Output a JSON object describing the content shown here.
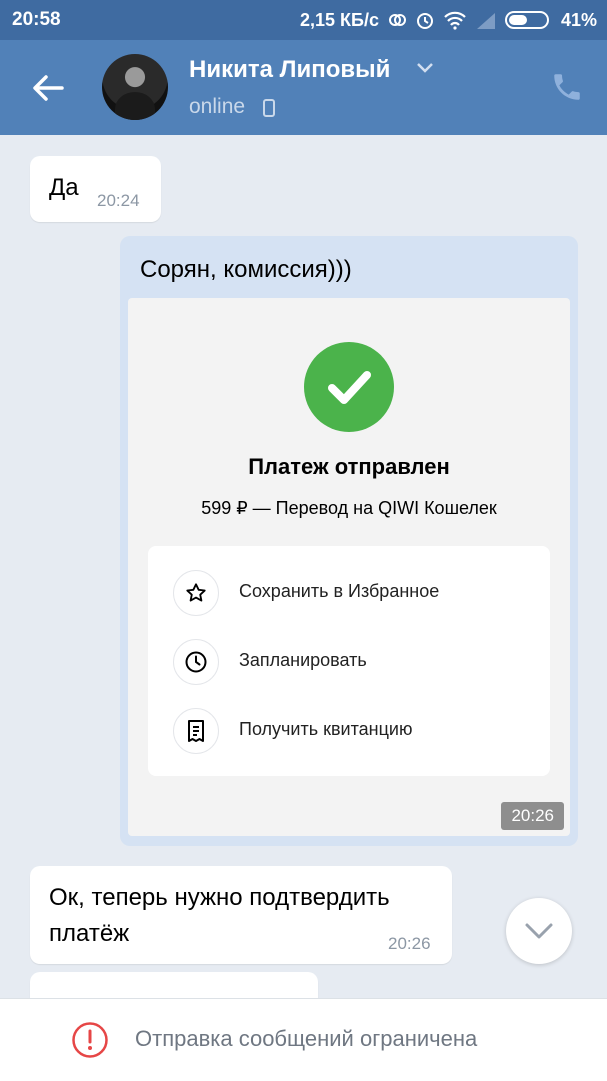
{
  "status_bar": {
    "time": "20:58",
    "speed": "2,15 КБ/с",
    "battery": "41%"
  },
  "header": {
    "contact_name": "Никита Липовый",
    "presence": "online",
    "icons": [
      "back-arrow-icon",
      "chevron-down-icon",
      "mobile-phone-icon",
      "phone-call-icon"
    ]
  },
  "messages": [
    {
      "text": "Да",
      "time": "20:24",
      "direction": "incoming"
    },
    {
      "text": "Сорян, комиссия)))",
      "direction": "outgoing",
      "payment_card": {
        "title": "Платеж отправлен",
        "subtitle": "599 ₽ — Перевод на QIWI Кошелек",
        "actions": [
          {
            "label": "Сохранить в Избранное",
            "icon": "star-icon"
          },
          {
            "label": "Запланировать",
            "icon": "clock-icon"
          },
          {
            "label": "Получить квитанцию",
            "icon": "receipt-icon"
          }
        ],
        "time": "20:26"
      }
    },
    {
      "text_line1": "Ок, теперь нужно подтвердить",
      "text_line2": "платёж",
      "time": "20:26",
      "direction": "incoming"
    }
  ],
  "footer": {
    "text": "Отправка сообщений ограничена",
    "icon": "warning-icon"
  },
  "colors": {
    "header": "#5181b8",
    "status_bar": "#3f6ba1",
    "background": "#e6ebf2",
    "outgoing_bubble": "#d5e2f3",
    "success": "#4bb34b"
  }
}
